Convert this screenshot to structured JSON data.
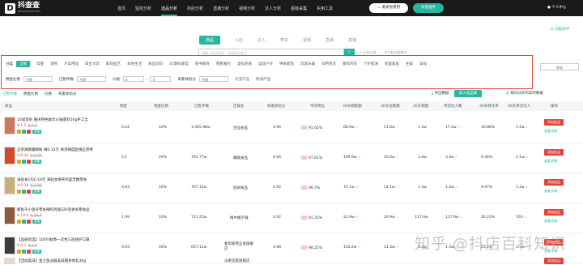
{
  "header": {
    "logo_name": "抖查查",
    "logo_url": "douchacha.com",
    "nav": [
      "首页",
      "监控分析",
      "选品分析",
      "抖店分析",
      "直播分析",
      "视频分析",
      "达人分析",
      "超级采集",
      "实用工具"
    ],
    "active_nav": 2,
    "vip_label": "邀请免费用",
    "plugin_label": "抖音插件",
    "user_label": "个人中心"
  },
  "tabs": [
    "商品",
    "小店",
    "达人",
    "带货",
    "视频",
    "直播",
    "直播"
  ],
  "assistant_label": "功能助手",
  "search": {
    "placeholder": "请输入商品链接，标题或关键字",
    "button_icon": "search-icon",
    "history_label": "历史记录",
    "diff_label": "对不起内容统计"
  },
  "filters": {
    "category_label": "分类",
    "categories": [
      "全部",
      "母婴",
      "宠物",
      "汽车用品",
      "珠宝文玩",
      "鲜花园艺",
      "本地生活",
      "食品饮料",
      "3C数码家电",
      "图书教育",
      "鞋靴箱包",
      "虚拟充值",
      "运动户外",
      "钟表配饰",
      "玩具乐器",
      "日用百货",
      "服饰内衣",
      "个护家清",
      "智能家居",
      "生鲜",
      "美妆"
    ],
    "multi_select_label": "多选",
    "row2": {
      "commission_label": "佣金比例",
      "commission_value": "不限",
      "fans_label": "已售件数",
      "fans_value": "不限",
      "price_label": "价格",
      "price_min": "0",
      "price_max": "0",
      "score_label": "商家体验分",
      "score_value": "不限",
      "link_label": "引流产品",
      "favor_label": "利润产品"
    }
  },
  "toolbar": {
    "tabs": [
      "已售件数",
      "佣金比例",
      "价格",
      "商家体验分"
    ],
    "export_label": "导出数据",
    "addlib_label": "加入选品库",
    "daily_label": "每日分析的实时数据"
  },
  "table": {
    "headers": [
      "商品",
      "佣金",
      "佣金比例",
      "已售件数",
      "店铺名",
      "商家体验分",
      "带货转化",
      "30天销售额",
      "30天访客数",
      "30天销量",
      "带货达人数",
      "30天转化率",
      "30天带货达人",
      "操作"
    ],
    "rows": [
      {
        "name": "10袋装的 重庆特色鲜炸火锅底料50g手工全",
        "price": "¥ 1.5",
        "orig": "¥ 5.8",
        "commission": "0.24",
        "rate": "16%",
        "sold": "1,925.98w",
        "shop": "佳仙食品",
        "score": "4.94",
        "conv": "91.65%",
        "sales": "68.9w",
        "visitors": "11.6w",
        "vol": "1.3w",
        "talents": "17.4w",
        "conv30": "16.88%",
        "talent30": "1.2w"
      },
      {
        "name": "正宗湖南螺蛳粉 辣0.33元 清汤辣度超嗨正宗特",
        "price": "¥ 0.33",
        "orig": "¥ 0.99",
        "commission": "0.1",
        "rate": "29%",
        "sold": "791.77w",
        "shop": "臻融食品",
        "score": "4.94",
        "conv": "97.61%",
        "sales": "109.9w",
        "visitors": "10.6w",
        "vol": "3.4w",
        "talents": "3.4w",
        "conv30": "9.46%",
        "talent30": "1.1w"
      },
      {
        "name": "海盐食1包0.19元 海盐食饼夹鸡蛋无糖零食",
        "price": "¥ 0.19",
        "orig": "¥ 0.99",
        "commission": "0.03",
        "rate": "16%",
        "sold": "767.14w",
        "shop": "招研食品",
        "score": "4.92",
        "conv": "96.7%",
        "sales": "74.1w",
        "visitors": "14.1w",
        "vol": "1.3w",
        "talents": "1.4w",
        "conv30": "9.97%",
        "talent30": "1.2w"
      },
      {
        "name": "鳕鱼干小鱼仔零食辣鸡鸡翅320克休闲零食品",
        "price": "¥ 19.9",
        "orig": "¥ 39.9",
        "commission": "1.99",
        "rate": "10%",
        "sold": "721.25w",
        "shop": "梅中姨子铺",
        "score": "4.92",
        "conv": "91.35%",
        "sales": "22.9w",
        "visitors": "20.9w",
        "vol": "117.9w",
        "talents": "117.9w",
        "conv30": "26.21%",
        "talent30": "703"
      },
      {
        "name": "【品质优选】100只蚊香一次性三层防护口罩",
        "price": "¥ 0.1",
        "orig": "¥ 0.2",
        "commission": "0.03",
        "rate": "26%",
        "sold": "657.12w",
        "shop": "蒙恩家用五金旗舰店",
        "score": "4.98",
        "conv": "98.25%",
        "sales": "150.2w",
        "visitors": "11.3w",
        "vol": "1.3w",
        "talents": "1.3w",
        "conv30": "23.2%",
        "talent30": "1.3w"
      },
      {
        "name": "【活动美白】金之鱼淡斑美白霜身体乳30g",
        "price": "",
        "orig": "",
        "commission": "",
        "rate": "",
        "sold": "",
        "shop": "法莱思庭旗舰店",
        "score": "",
        "conv": "",
        "sales": "",
        "visitors": "",
        "vol": "",
        "talents": "",
        "conv30": "",
        "talent30": ""
      }
    ],
    "op_primary": "添加选品",
    "op_secondary": "查看详情"
  },
  "watermark": "知乎 @抖店百科知识",
  "colors": {
    "accent": "#2ab5a0",
    "danger": "#e0453a",
    "topbar": "#1a1a1a"
  }
}
